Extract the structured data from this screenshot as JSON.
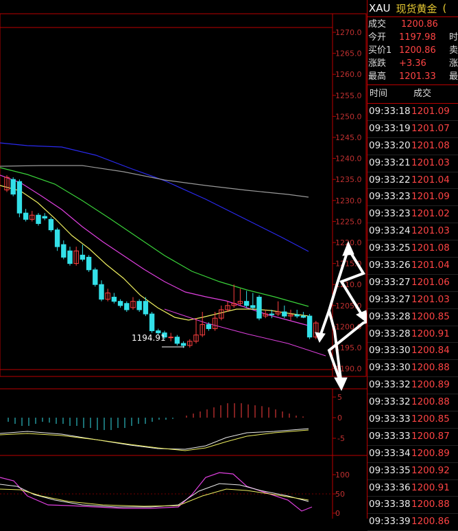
{
  "panel": {
    "symbol": "XAU",
    "name": "现货黄金",
    "extra": "(",
    "quotes": [
      {
        "label": "成交",
        "value": "1200.86",
        "extra": ""
      },
      {
        "label": "今开",
        "value": "1197.98",
        "extra": "时"
      },
      {
        "label": "买价1",
        "value": "1200.86",
        "extra": "卖"
      },
      {
        "label": "涨跌",
        "value": "+3.36",
        "extra": "涨"
      },
      {
        "label": "最高",
        "value": "1201.33",
        "extra": "最"
      }
    ],
    "tick_header": {
      "time": "时间",
      "price": "成交"
    },
    "ticks": [
      {
        "time": "09:33:18",
        "price": "1201.09"
      },
      {
        "time": "09:33:19",
        "price": "1201.07"
      },
      {
        "time": "09:33:20",
        "price": "1201.08"
      },
      {
        "time": "09:33:21",
        "price": "1201.03"
      },
      {
        "time": "09:33:22",
        "price": "1201.04"
      },
      {
        "time": "09:33:23",
        "price": "1201.09"
      },
      {
        "time": "09:33:23",
        "price": "1201.02"
      },
      {
        "time": "09:33:24",
        "price": "1201.03"
      },
      {
        "time": "09:33:25",
        "price": "1201.08"
      },
      {
        "time": "09:33:26",
        "price": "1201.04"
      },
      {
        "time": "09:33:27",
        "price": "1201.06"
      },
      {
        "time": "09:33:27",
        "price": "1201.03"
      },
      {
        "time": "09:33:28",
        "price": "1200.85"
      },
      {
        "time": "09:33:28",
        "price": "1200.91"
      },
      {
        "time": "09:33:30",
        "price": "1200.84"
      },
      {
        "time": "09:33:30",
        "price": "1200.88"
      },
      {
        "time": "09:33:32",
        "price": "1200.89"
      },
      {
        "time": "09:33:32",
        "price": "1200.88"
      },
      {
        "time": "09:33:33",
        "price": "1200.85"
      },
      {
        "time": "09:33:33",
        "price": "1200.87"
      },
      {
        "time": "09:33:34",
        "price": "1200.89"
      },
      {
        "time": "09:33:35",
        "price": "1200.92"
      },
      {
        "time": "09:33:36",
        "price": "1200.91"
      },
      {
        "time": "09:33:38",
        "price": "1200.88"
      },
      {
        "time": "09:33:39",
        "price": "1200.86"
      }
    ]
  },
  "chart": {
    "price_axis": [
      "1270.0",
      "1265.0",
      "1260.0",
      "1255.0",
      "1250.0",
      "1245.0",
      "1240.0",
      "1235.0",
      "1230.0",
      "1225.0",
      "1220.0",
      "1215.0",
      "1210.0",
      "1205.0",
      "1200.0",
      "1195.0",
      "1190.0"
    ],
    "low_annotation": "1194.91",
    "macd_axis": [
      "5",
      "0",
      "-5"
    ],
    "kdj_axis": [
      "100",
      "50",
      "0"
    ],
    "candles": [
      [
        1232.5,
        1235.5,
        1236,
        1232
      ],
      [
        1235,
        1231.5,
        1235.5,
        1231
      ],
      [
        1234.5,
        1227,
        1235,
        1226
      ],
      [
        1227,
        1225.5,
        1228,
        1225
      ],
      [
        1225.5,
        1226.5,
        1227.5,
        1225
      ],
      [
        1226.5,
        1224.5,
        1227,
        1224
      ],
      [
        1226.2,
        1225.8,
        1227,
        1225.3
      ],
      [
        1225.5,
        1223,
        1226,
        1222.5
      ],
      [
        1223,
        1219,
        1223.5,
        1218
      ],
      [
        1219.5,
        1216.5,
        1220.5,
        1216
      ],
      [
        1218,
        1215,
        1219,
        1214.5
      ],
      [
        1215,
        1218,
        1219,
        1214.5
      ],
      [
        1217,
        1216,
        1219.5,
        1215.5
      ],
      [
        1216.5,
        1213.5,
        1217,
        1213
      ],
      [
        1213.5,
        1210,
        1214,
        1209.5
      ],
      [
        1210,
        1206.5,
        1211,
        1206
      ],
      [
        1206.5,
        1208,
        1209,
        1206
      ],
      [
        1207,
        1206,
        1208,
        1205.5
      ],
      [
        1206,
        1205,
        1206.5,
        1204.5
      ],
      [
        1205.5,
        1204,
        1206,
        1203.5
      ],
      [
        1204.5,
        1206,
        1207,
        1204
      ],
      [
        1206,
        1204,
        1206.5,
        1203.5
      ],
      [
        1206,
        1203,
        1207,
        1202.5
      ],
      [
        1203,
        1199,
        1203.5,
        1198.5
      ],
      [
        1199,
        1198.5,
        1199.5,
        1198
      ],
      [
        1198.5,
        1197.5,
        1199,
        1197
      ],
      [
        1197.5,
        1197.5,
        1198.5,
        1196.5
      ],
      [
        1197.5,
        1196,
        1198,
        1195.5
      ],
      [
        1196,
        1195.5,
        1196.5,
        1194.91
      ],
      [
        1195.5,
        1196.5,
        1197,
        1195
      ],
      [
        1196.5,
        1198,
        1202,
        1196
      ],
      [
        1198,
        1200.5,
        1203.5,
        1197.5
      ],
      [
        1200.5,
        1199.5,
        1201,
        1199
      ],
      [
        1199.5,
        1202,
        1203.5,
        1199
      ],
      [
        1202,
        1204,
        1205,
        1201.5
      ],
      [
        1204,
        1205,
        1206,
        1203.5
      ],
      [
        1205,
        1205.5,
        1210,
        1204.5
      ],
      [
        1205.5,
        1206,
        1209,
        1205
      ],
      [
        1206,
        1205,
        1208.5,
        1204.5
      ],
      [
        1205,
        1204.5,
        1208,
        1204
      ],
      [
        1207,
        1202,
        1207.5,
        1201.5
      ],
      [
        1202.5,
        1203,
        1204,
        1202
      ],
      [
        1203,
        1202.8,
        1204,
        1202
      ],
      [
        1203,
        1203.5,
        1206,
        1202.5
      ],
      [
        1203.5,
        1202.5,
        1205,
        1202
      ],
      [
        1202.5,
        1202.8,
        1204,
        1201.5
      ],
      [
        1202.8,
        1202.5,
        1204,
        1202
      ],
      [
        1202.5,
        1202.2,
        1203.5,
        1202
      ],
      [
        1202.5,
        1197.5,
        1203,
        1197
      ],
      [
        1197.5,
        1200.86,
        1201.33,
        1197
      ]
    ]
  }
}
